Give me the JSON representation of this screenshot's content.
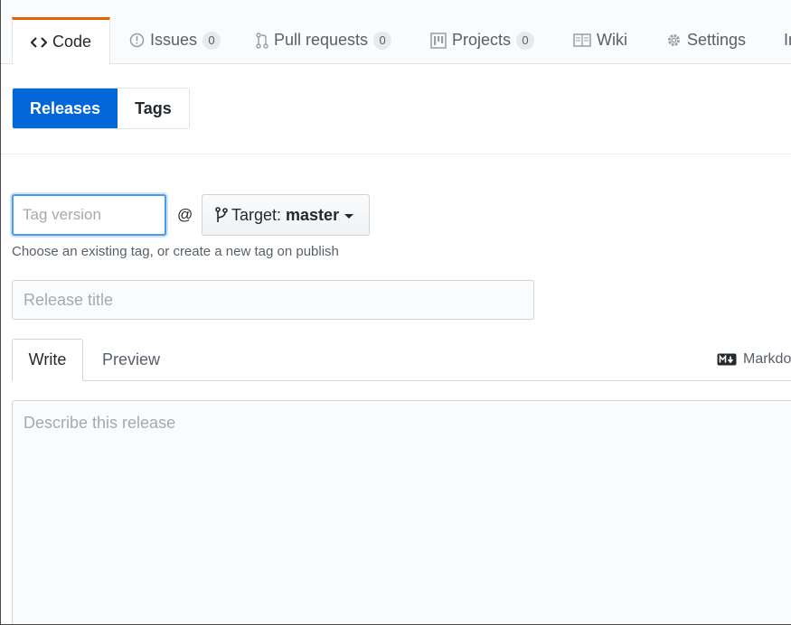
{
  "repo_nav": {
    "tabs": [
      {
        "label": "Code",
        "icon": "code-icon",
        "selected": true
      },
      {
        "label": "Issues",
        "icon": "issue-opened-icon",
        "count": "0"
      },
      {
        "label": "Pull requests",
        "icon": "git-pull-request-icon",
        "count": "0"
      },
      {
        "label": "Projects",
        "icon": "project-icon",
        "count": "0"
      },
      {
        "label": "Wiki",
        "icon": "book-icon"
      },
      {
        "label": "Settings",
        "icon": "gear-icon"
      },
      {
        "label": "In"
      }
    ]
  },
  "subnav": {
    "releases_label": "Releases",
    "tags_label": "Tags"
  },
  "tag": {
    "placeholder": "Tag version",
    "at": "@",
    "target_prefix": "Target:",
    "target_branch": "master",
    "hint": "Choose an existing tag, or create a new tag on publish"
  },
  "release_title": {
    "placeholder": "Release title"
  },
  "editor": {
    "write_label": "Write",
    "preview_label": "Preview",
    "markdown_label": "Markdo",
    "markdown_icon": "markdown-icon",
    "description_placeholder": "Describe this release"
  },
  "colors": {
    "accent_blue": "#0366d6",
    "selected_tab_border": "#e36209",
    "focus_border": "#4a9ce8"
  }
}
